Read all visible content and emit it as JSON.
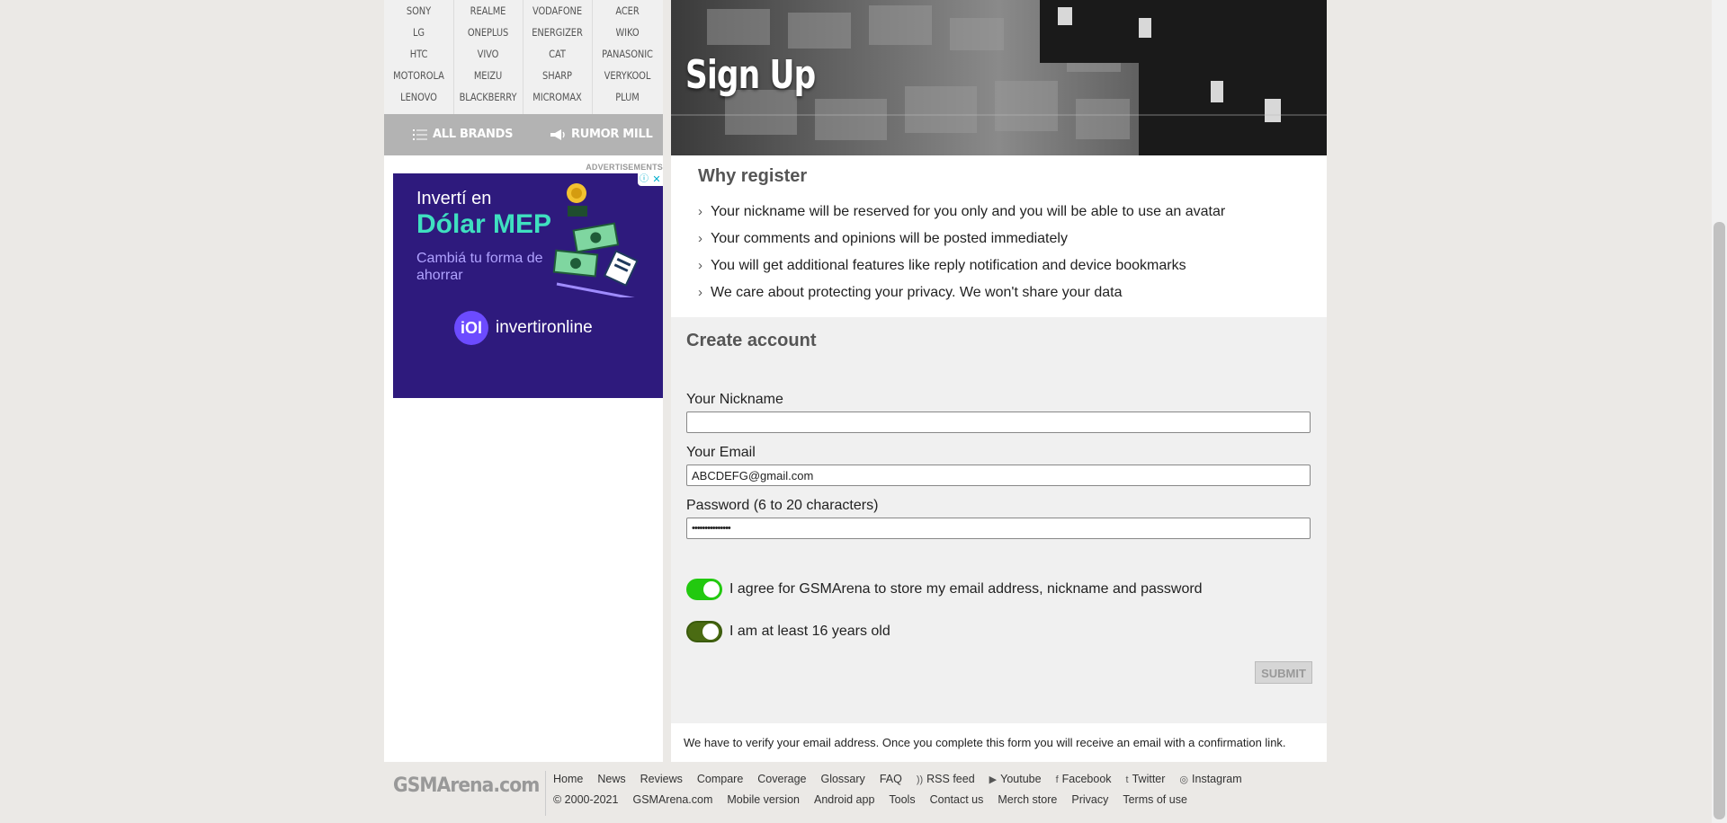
{
  "brands": {
    "columns": [
      [
        "SONY",
        "LG",
        "HTC",
        "MOTOROLA",
        "LENOVO"
      ],
      [
        "REALME",
        "ONEPLUS",
        "VIVO",
        "MEIZU",
        "BLACKBERRY"
      ],
      [
        "VODAFONE",
        "ENERGIZER",
        "CAT",
        "SHARP",
        "MICROMAX"
      ],
      [
        "ACER",
        "WIKO",
        "PANASONIC",
        "VERYKOOL",
        "PLUM"
      ]
    ],
    "all_brands_label": "ALL BRANDS",
    "rumor_mill_label": "RUMOR MILL"
  },
  "ads": {
    "label": "ADVERTISEMENTS",
    "line1": "Invertí en",
    "line2": "Dólar MEP",
    "line3": "Cambiá tu forma de ahorrar",
    "logo_mark": "iOl",
    "logo_text": "invertironline"
  },
  "hero": {
    "title": "Sign Up"
  },
  "why_register": {
    "title": "Why register",
    "items": [
      "Your nickname will be reserved for you only and you will be able to use an avatar",
      "Your comments and opinions will be posted immediately",
      "You will get additional features like reply notification and device bookmarks",
      "We care about protecting your privacy. We won't share your data"
    ]
  },
  "create_account": {
    "title": "Create account",
    "nickname_label": "Your Nickname",
    "nickname_value": "",
    "email_label": "Your Email",
    "email_value": "ABCDEFG@gmail.com",
    "password_label": "Password (6 to 20 characters)",
    "password_value": "•••••••••••••••",
    "agree_label": "I agree for GSMArena to store my email address, nickname and password",
    "age_label": "I am at least 16 years old",
    "submit_label": "SUBMIT",
    "verify_note": "We have to verify your email address. Once you complete this form you will receive an email with a confirmation link."
  },
  "footer": {
    "logo": "GSMArena.com",
    "row1": [
      "Home",
      "News",
      "Reviews",
      "Compare",
      "Coverage",
      "Glossary",
      "FAQ",
      "RSS feed",
      "Youtube",
      "Facebook",
      "Twitter",
      "Instagram"
    ],
    "row2": [
      "© 2000-2021",
      "GSMArena.com",
      "Mobile version",
      "Android app",
      "Tools",
      "Contact us",
      "Merch store",
      "Privacy",
      "Terms of use"
    ]
  },
  "colors": {
    "toggle_on": "#22c90f",
    "toggle_on_dark": "#4a6b12",
    "ad_bg": "#2e1a7d",
    "ad_accent": "#3fe0c0"
  }
}
